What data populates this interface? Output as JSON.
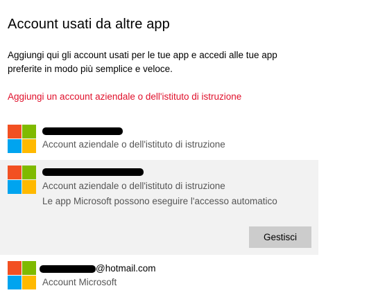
{
  "title": "Account usati da altre app",
  "description": "Aggiungi qui gli account usati per le tue app e accedi alle tue app preferite in modo più semplice e veloce.",
  "add_account_link": "Aggiungi un account aziendale o dell'istituto di istruzione",
  "logo_colors": [
    "#f25022",
    "#7fba00",
    "#00a4ef",
    "#ffb900"
  ],
  "accent_color": "#e0102b",
  "accounts": [
    {
      "name_redacted": true,
      "type": "Account aziendale o dell'istituto di istruzione"
    },
    {
      "name_redacted": true,
      "type": "Account aziendale o dell'istituto di istruzione",
      "note": "Le app Microsoft possono eseguire l'accesso automatico",
      "manage_label": "Gestisci",
      "selected": true
    },
    {
      "email_suffix": "@hotmail.com",
      "type": "Account Microsoft"
    }
  ]
}
